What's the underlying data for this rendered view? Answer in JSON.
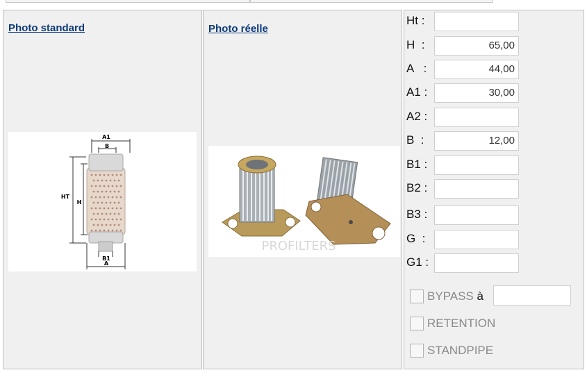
{
  "panels": {
    "standard": {
      "title": "Photo standard"
    },
    "real": {
      "title": "Photo réelle",
      "watermark": "PROFILTERS"
    }
  },
  "diagram_labels": {
    "a1": "A1",
    "b": "B",
    "ht": "HT",
    "h": "H",
    "b1": "B1",
    "a": "A"
  },
  "dimensions": [
    {
      "label": "Ht :",
      "value": ""
    },
    {
      "label": "H  :",
      "value": "65,00"
    },
    {
      "label": "A   :",
      "value": "44,00"
    },
    {
      "label": "A1 :",
      "value": "30,00"
    },
    {
      "label": "A2 :",
      "value": ""
    },
    {
      "label": "B  :",
      "value": "12,00"
    },
    {
      "label": "B1 :",
      "value": ""
    },
    {
      "label": "B2 :",
      "value": ""
    },
    {
      "label": "B3 :",
      "value": ""
    },
    {
      "label": "G  :",
      "value": ""
    },
    {
      "label": "G1 :",
      "value": ""
    }
  ],
  "options": {
    "bypass": {
      "label": "BYPASS",
      "suffix": " à",
      "value": ""
    },
    "retention": {
      "label": "RETENTION"
    },
    "standpipe": {
      "label": "STANDPIPE"
    }
  }
}
